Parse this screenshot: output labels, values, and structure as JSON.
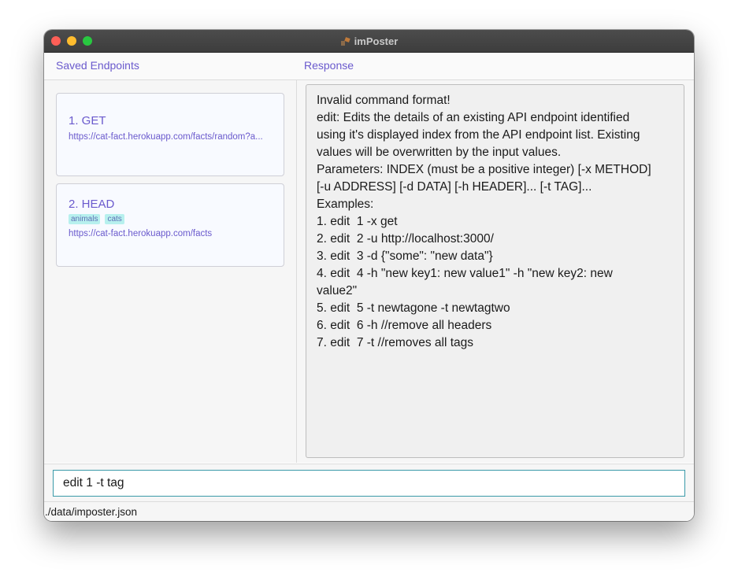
{
  "window": {
    "title": "imPoster"
  },
  "headers": {
    "endpoints_label": "Saved Endpoints",
    "response_label": "Response"
  },
  "endpoints": [
    {
      "title": "1.  GET",
      "url": "https://cat-fact.herokuapp.com/facts/random?a...",
      "tags": []
    },
    {
      "title": "2.  HEAD",
      "url": "https://cat-fact.herokuapp.com/facts",
      "tags": [
        "animals",
        "cats"
      ]
    }
  ],
  "response": {
    "text": "Invalid command format!\nedit: Edits the details of an existing API endpoint identified\nusing it's displayed index from the API endpoint list. Existing\nvalues will be overwritten by the input values.\nParameters: INDEX (must be a positive integer) [-x METHOD]\n[-u ADDRESS] [-d DATA] [-h HEADER]... [-t TAG]...\nExamples:\n1. edit  1 -x get\n2. edit  2 -u http://localhost:3000/\n3. edit  3 -d {\"some\": \"new data\"}\n4. edit  4 -h \"new key1: new value1\" -h \"new key2: new\nvalue2\"\n5. edit  5 -t newtagone -t newtagtwo\n6. edit  6 -h //remove all headers\n7. edit  7 -t //removes all tags"
  },
  "command": {
    "value": "edit 1 -t tag"
  },
  "status": {
    "path": "./data/imposter.json"
  },
  "icons": {
    "app_icon": "imposter-app-icon"
  },
  "colors": {
    "accent": "#6a5acd",
    "tag_bg": "#b7f0ee",
    "input_border": "#3a9aa8"
  }
}
